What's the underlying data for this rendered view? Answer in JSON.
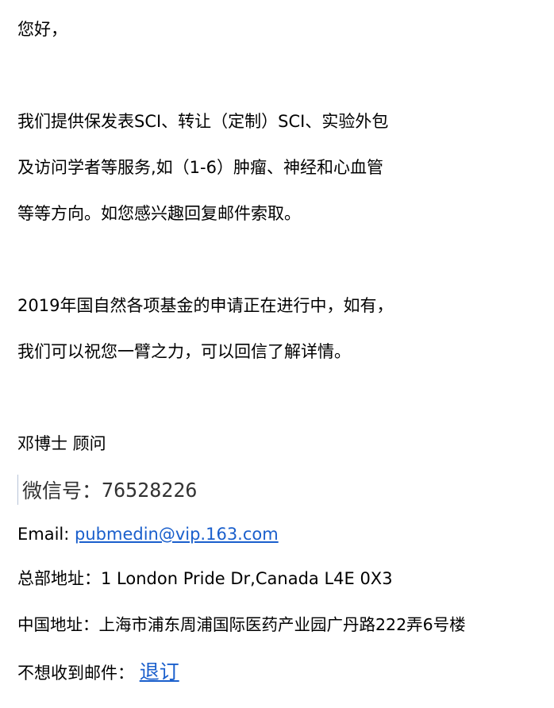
{
  "email": {
    "greeting": "您好，",
    "intro": [
      "我们提供保发表SCI、转让（定制）SCI、实验外包",
      "及访问学者等服务,如（1-6）肿瘤、神经和心血管",
      "等等方向。如您感兴趣回复邮件索取。"
    ],
    "funding": [
      "2019年国自然各项基金的申请正在进行中，如有，",
      "我们可以祝您一臂之力，可以回信了解详情。"
    ],
    "signature": {
      "name": "邓博士 顾问",
      "wechat_label": "微信号：",
      "wechat_id": "76528226",
      "email_label": "Email: ",
      "email_address": "pubmedin@vip.163.com",
      "hq_label": "总部地址：",
      "hq_address": "1 London Pride Dr,Canada L4E 0X3",
      "cn_label": "中国地址：",
      "cn_address": "上海市浦东周浦国际医药产业园广丹路222弄6号楼"
    },
    "unsubscribe": {
      "text": "不想收到邮件：",
      "link": "退订"
    },
    "colors": {
      "link": "#1a5fcc",
      "text": "#000000"
    }
  }
}
